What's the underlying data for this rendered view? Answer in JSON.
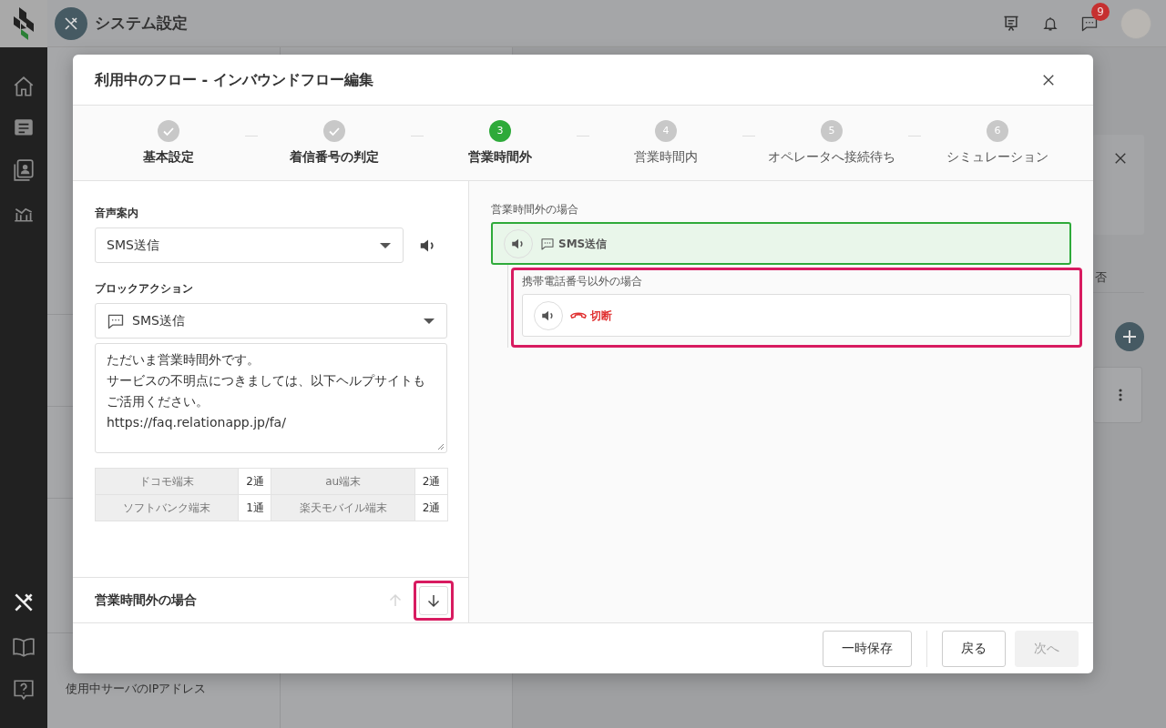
{
  "header": {
    "title": "システム設定",
    "badge": "9"
  },
  "rail": [
    {
      "selected": false
    },
    {
      "selected": false
    },
    {
      "selected": false
    },
    {
      "selected": false
    },
    {
      "selected": true
    },
    {
      "selected": false
    },
    {
      "selected": false
    }
  ],
  "sidebar": [
    {
      "text": "使用中サーバのIPアドレス"
    }
  ],
  "content": {
    "tab_fragment": "否"
  },
  "modal": {
    "title": "利用中のフロー - インバウンドフロー編集",
    "steps": [
      {
        "label": "基本設定",
        "completed": true,
        "selected": false
      },
      {
        "label": "着信番号の判定",
        "completed": true,
        "selected": false
      },
      {
        "number": "3",
        "label": "営業時間外",
        "completed": false,
        "selected": true
      },
      {
        "number": "4",
        "label": "営業時間内",
        "completed": false,
        "selected": false
      },
      {
        "number": "5",
        "label": "オペレータへ接続待ち",
        "completed": false,
        "selected": false
      },
      {
        "number": "6",
        "label": "シミュレーション",
        "completed": false,
        "selected": false
      }
    ],
    "voice": {
      "label": "音声案内",
      "value": "SMS送信"
    },
    "action": {
      "label": "ブロックアクション",
      "value": "SMS送信",
      "message_lines": [
        "ただいま営業時間外です。",
        "サービスの不明点につきましては、以下ヘルプサイトもご活用ください。",
        "https://faq.relationapp.jp/fa/"
      ]
    },
    "carriers": [
      {
        "name": "ドコモ端末",
        "count": "2通"
      },
      {
        "name": "au端末",
        "count": "2通"
      },
      {
        "name": "ソフトバンク端末",
        "count": "1通"
      },
      {
        "name": "楽天モバイル端末",
        "count": "2通"
      }
    ],
    "section": {
      "title": "営業時間外の場合",
      "up_disabled": true,
      "down_highlighted": true
    },
    "flow": {
      "label": "営業時間外の場合",
      "node": {
        "kind": "sms",
        "text": "SMS送信",
        "selected": true
      },
      "branch": {
        "label": "携帯電話番号以外の場合",
        "highlighted": true,
        "node": {
          "kind": "hangup",
          "text": "切断",
          "selected": false
        }
      }
    },
    "footer": [
      {
        "label": "一時保存",
        "disabled": false
      },
      {
        "label": "戻る",
        "disabled": false
      },
      {
        "label": "次へ",
        "disabled": true
      }
    ]
  }
}
